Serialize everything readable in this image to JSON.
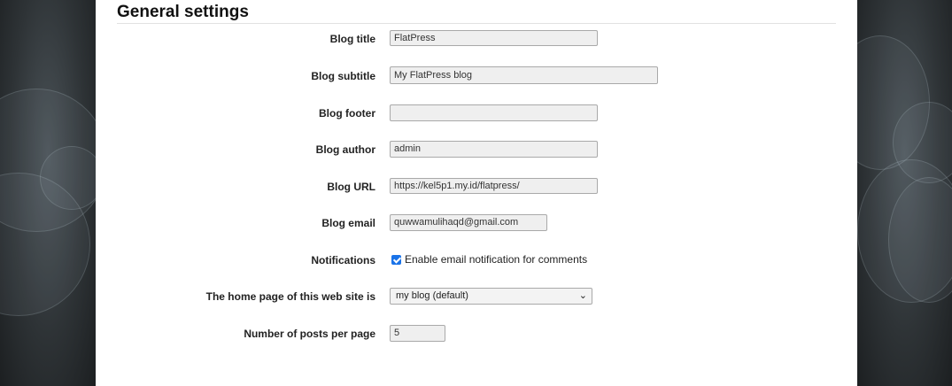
{
  "section": {
    "title": "General settings"
  },
  "fields": {
    "blog_title": {
      "label": "Blog title",
      "value": "FlatPress"
    },
    "blog_subtitle": {
      "label": "Blog subtitle",
      "value": "My FlatPress blog"
    },
    "blog_footer": {
      "label": "Blog footer",
      "value": ""
    },
    "blog_author": {
      "label": "Blog author",
      "value": "admin"
    },
    "blog_url": {
      "label": "Blog URL",
      "value": "https://kel5p1.my.id/flatpress/"
    },
    "blog_email": {
      "label": "Blog email",
      "value": "quwwamulihaqd@gmail.com"
    },
    "notifications": {
      "label": "Notifications",
      "checkbox_label": "Enable email notification for comments",
      "checked": true
    },
    "home_page": {
      "label": "The home page of this web site is",
      "selected": "my blog (default)"
    },
    "posts_per_page": {
      "label": "Number of posts per page",
      "value": "5"
    }
  },
  "colors": {
    "checkbox_accent": "#1a73e8",
    "page_bg": "#2b2f33"
  }
}
